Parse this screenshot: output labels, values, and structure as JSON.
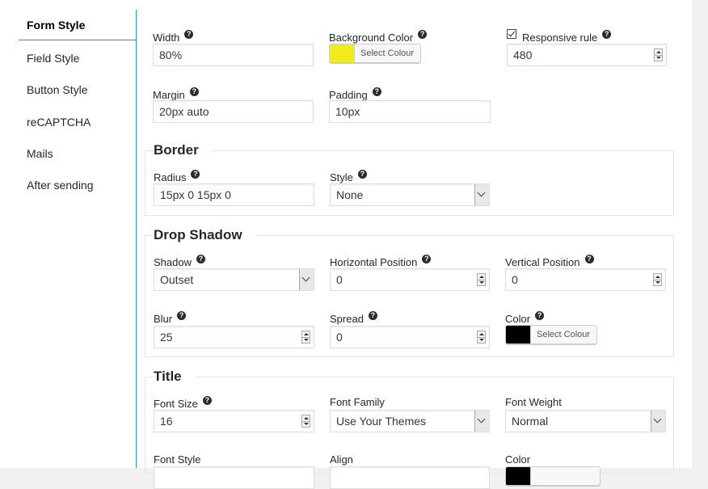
{
  "sidebar": {
    "items": [
      {
        "label": "Form Style"
      },
      {
        "label": "Field Style"
      },
      {
        "label": "Button Style"
      },
      {
        "label": "reCAPTCHA"
      },
      {
        "label": "Mails"
      },
      {
        "label": "After sending"
      }
    ],
    "active_index": 0
  },
  "help_glyph": "?",
  "general": {
    "width": {
      "label": "Width",
      "value": "80%"
    },
    "background_color": {
      "label": "Background Color",
      "button": "Select Colour",
      "color": "#f0eb1a"
    },
    "responsive_rule": {
      "label": "Responsive rule",
      "checked": true,
      "value": "480"
    },
    "margin": {
      "label": "Margin",
      "value": "20px auto"
    },
    "padding": {
      "label": "Padding",
      "value": "10px"
    }
  },
  "border": {
    "title": "Border",
    "radius": {
      "label": "Radius",
      "value": "15px 0 15px 0"
    },
    "style": {
      "label": "Style",
      "value": "None"
    }
  },
  "drop_shadow": {
    "title": "Drop Shadow",
    "shadow": {
      "label": "Shadow",
      "value": "Outset"
    },
    "horizontal": {
      "label": "Horizontal Position",
      "value": "0"
    },
    "vertical": {
      "label": "Vertical Position",
      "value": "0"
    },
    "blur": {
      "label": "Blur",
      "value": "25"
    },
    "spread": {
      "label": "Spread",
      "value": "0"
    },
    "color": {
      "label": "Color",
      "button": "Select Colour",
      "color": "#000000"
    }
  },
  "title_section": {
    "title": "Title",
    "font_size": {
      "label": "Font Size",
      "value": "16"
    },
    "font_family": {
      "label": "Font Family",
      "value": "Use Your Themes"
    },
    "font_weight": {
      "label": "Font Weight",
      "value": "Normal"
    },
    "font_style": {
      "label": "Font Style"
    },
    "align": {
      "label": "Align"
    },
    "color": {
      "label": "Color",
      "color": "#000000"
    }
  }
}
